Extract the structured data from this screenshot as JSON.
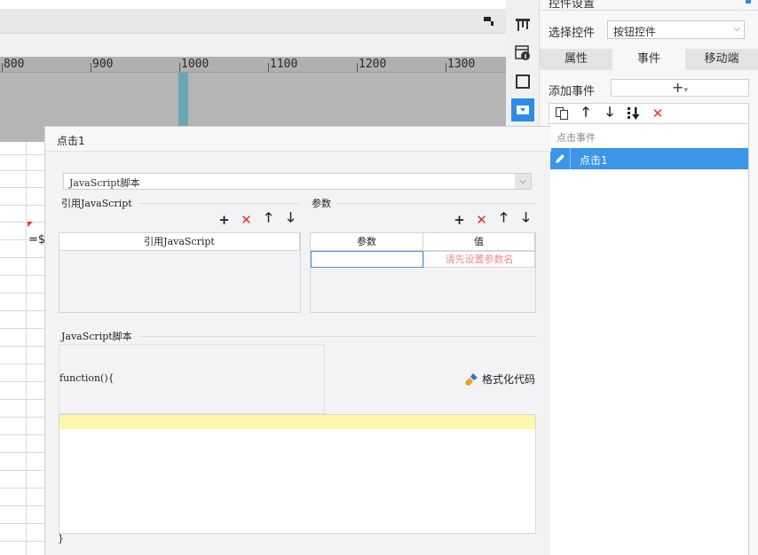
{
  "editor_bg": {
    "ruler_labels": [
      "800",
      "900",
      "1000",
      "1100",
      "1200",
      "1300"
    ],
    "cell_formula": "=$"
  },
  "icon_strip": {
    "icons": [
      "frame-icon",
      "table-info-icon",
      "square-icon",
      "dropdown-widget-icon"
    ]
  },
  "right_panel": {
    "top_title": "控件设置",
    "select_label": "选择控件",
    "select_value": "按钮控件",
    "tabs": [
      {
        "label": "属性",
        "active": false
      },
      {
        "label": "事件",
        "active": true
      },
      {
        "label": "移动端",
        "active": false
      }
    ],
    "add_event_label": "添加事件",
    "add_event_button": "+",
    "event_group": "点击事件",
    "event_item": "点击1"
  },
  "dialog": {
    "title": "点击1",
    "type_value": "JavaScript脚本",
    "ref_section": "引用JavaScript",
    "ref_col": "引用JavaScript",
    "param_section": "参数",
    "param_cols": [
      "参数",
      "值"
    ],
    "param_placeholder": "请先设置参数名",
    "script_section": "JavaScript脚本",
    "fn_head": "function(){",
    "format_label": "格式化代码",
    "fn_close": "}"
  },
  "colors": {
    "accent": "#2b8de8",
    "selected_row": "#3b95e8",
    "delete_red": "#e03030",
    "editor_highlight": "#fdf7a8"
  }
}
